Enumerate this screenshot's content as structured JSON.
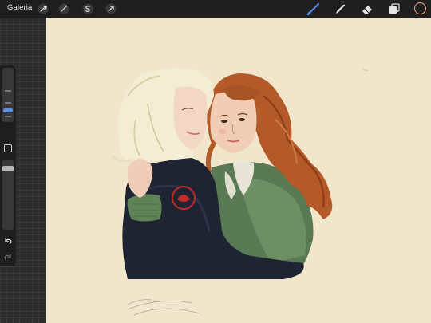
{
  "topbar": {
    "gallery_label": "Galeria",
    "tools": [
      "wrench-icon",
      "magic-wand-icon",
      "selection-s-icon",
      "transform-arrow-icon"
    ],
    "right_tools": [
      "brush-icon",
      "smudge-icon",
      "eraser-icon",
      "layers-icon"
    ],
    "active_tool": "brush",
    "color_swatch": "#f1a07d",
    "accent": "#4f86ea"
  },
  "sidebar": {
    "controls": [
      "brush-size-slider",
      "modify-button",
      "opacity-slider",
      "undo-icon",
      "redo-icon"
    ]
  },
  "canvas": {
    "background": "#f1e6cb"
  }
}
